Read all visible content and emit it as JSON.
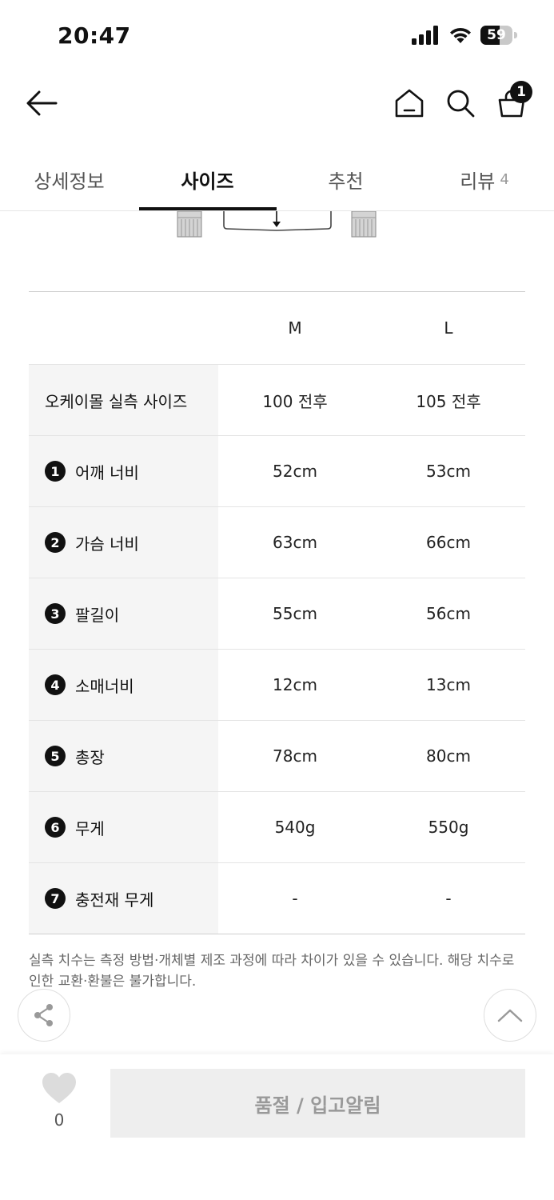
{
  "status_bar": {
    "time": "20:47",
    "battery": "59",
    "battery_level": 0.59
  },
  "header": {
    "cart_count": "1"
  },
  "tabs": [
    {
      "label": "상세정보",
      "count": ""
    },
    {
      "label": "사이즈",
      "count": ""
    },
    {
      "label": "추천",
      "count": ""
    },
    {
      "label": "리뷰",
      "count": "4"
    }
  ],
  "size_table": {
    "columns": [
      "M",
      "L"
    ],
    "rows": [
      {
        "num": "",
        "label": "오케이몰 실측 사이즈",
        "values": [
          "100 전후",
          "105 전후"
        ]
      },
      {
        "num": "1",
        "label": "어깨 너비",
        "values": [
          "52cm",
          "53cm"
        ]
      },
      {
        "num": "2",
        "label": "가슴 너비",
        "values": [
          "63cm",
          "66cm"
        ]
      },
      {
        "num": "3",
        "label": "팔길이",
        "values": [
          "55cm",
          "56cm"
        ]
      },
      {
        "num": "4",
        "label": "소매너비",
        "values": [
          "12cm",
          "13cm"
        ]
      },
      {
        "num": "5",
        "label": "총장",
        "values": [
          "78cm",
          "80cm"
        ]
      },
      {
        "num": "6",
        "label": "무게",
        "values": [
          "540g",
          "550g"
        ]
      },
      {
        "num": "7",
        "label": "충전재 무게",
        "values": [
          "-",
          "-"
        ]
      }
    ]
  },
  "note": "실측 치수는 측정 방법·개체별 제조 과정에 따라 차이가 있을 수 있습니다. 해당 치수로 인한 교환·환불은 불가합니다.",
  "bottom_bar": {
    "like_count": "0",
    "soldout_label": "품절 / 입고알림"
  },
  "icons": [
    "back-arrow-icon",
    "home-icon",
    "search-icon",
    "cart-icon",
    "share-icon",
    "chevron-up-icon",
    "heart-icon"
  ]
}
